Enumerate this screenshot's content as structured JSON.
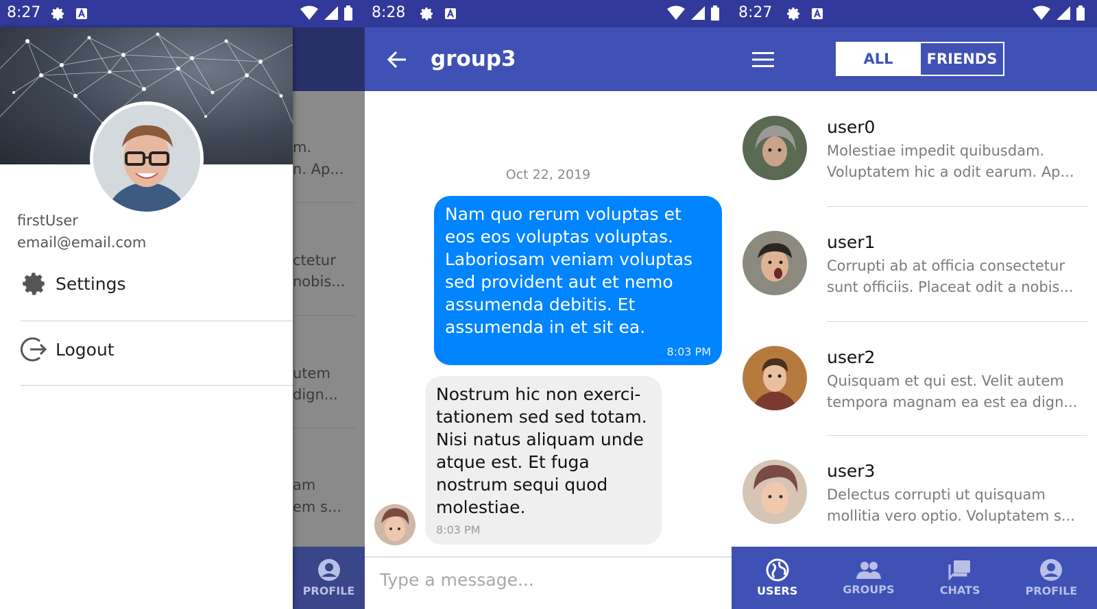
{
  "screens": {
    "drawer": {
      "status_time": "8:27",
      "user_name": "firstUser",
      "user_email": "email@email.com",
      "menu": [
        {
          "label": "Settings",
          "icon": "gear-icon"
        },
        {
          "label": "Logout",
          "icon": "logout-icon"
        }
      ],
      "background_fragments": [
        "m.",
        "n. Ap...",
        "ctetur",
        "nobis...",
        "utem",
        "dign...",
        "am",
        "em s..."
      ],
      "nav_visible_label": "PROFILE"
    },
    "chat": {
      "status_time": "8:28",
      "title": "group3",
      "date": "Oct 22, 2019",
      "messages": [
        {
          "direction": "outgoing",
          "text": "Nam quo rerum voluptas et eos eos voluptas voluptas. Laboriosam veniam voluptas sed provident aut et nemo assumenda debitis. Et assumenda in et sit ea.",
          "time": "8:03 PM"
        },
        {
          "direction": "incoming",
          "text": "Nostrum hic non exerci-tationem sed sed totam. Nisi natus aliquam unde atque est. Et fuga nostrum sequi quod molestiae.",
          "time": "8:03 PM"
        }
      ],
      "input_placeholder": "Type a message..."
    },
    "users": {
      "status_time": "8:27",
      "toggle": {
        "all": "ALL",
        "friends": "FRIENDS",
        "selected": "ALL"
      },
      "list": [
        {
          "name": "user0",
          "message": "Molestiae impedit quibusdam. Voluptatem hic a odit earum. Ap..."
        },
        {
          "name": "user1",
          "message": "Corrupti ab at officia consectetur sunt officiis. Placeat odit a nobis..."
        },
        {
          "name": "user2",
          "message": "Quisquam et qui est. Velit autem tempora magnam ea est ea dign..."
        },
        {
          "name": "user3",
          "message": "Delectus corrupti ut quisquam mollitia vero optio. Voluptatem s..."
        }
      ],
      "nav": [
        {
          "label": "USERS",
          "icon": "globe-icon",
          "active": true
        },
        {
          "label": "GROUPS",
          "icon": "groups-icon",
          "active": false
        },
        {
          "label": "CHATS",
          "icon": "chats-icon",
          "active": false
        },
        {
          "label": "PROFILE",
          "icon": "profile-icon",
          "active": false
        }
      ]
    }
  },
  "colors": {
    "status_bar": "#31399b",
    "primary": "#3f51b5",
    "outgoing_bubble": "#0084ff",
    "incoming_bubble": "#efefef"
  }
}
